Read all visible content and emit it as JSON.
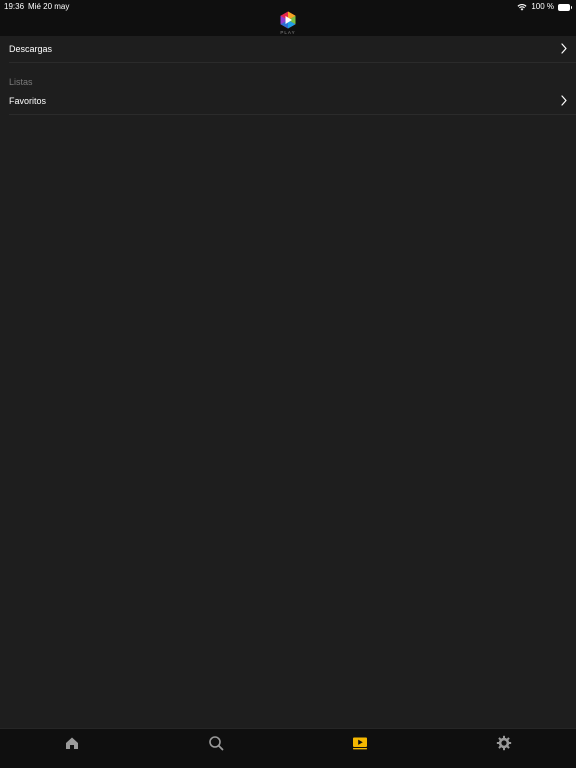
{
  "status_bar": {
    "time": "19:36",
    "date": "Mié 20 may",
    "battery": "100 %"
  },
  "header": {
    "logo_text": "PLAY"
  },
  "list": {
    "downloads_label": "Descargas",
    "section_title": "Listas",
    "favorites_label": "Favoritos"
  },
  "tabbar": {
    "items": [
      {
        "icon": "home-icon",
        "active": false
      },
      {
        "icon": "search-icon",
        "active": false
      },
      {
        "icon": "my-videos-icon",
        "active": true
      },
      {
        "icon": "gear-icon",
        "active": false
      }
    ]
  },
  "colors": {
    "background": "#1e1e1e",
    "header": "#0f0f0f",
    "accent": "#f5b800",
    "muted_text": "#7a7a7a",
    "icon_inactive": "#9a9a9a"
  }
}
